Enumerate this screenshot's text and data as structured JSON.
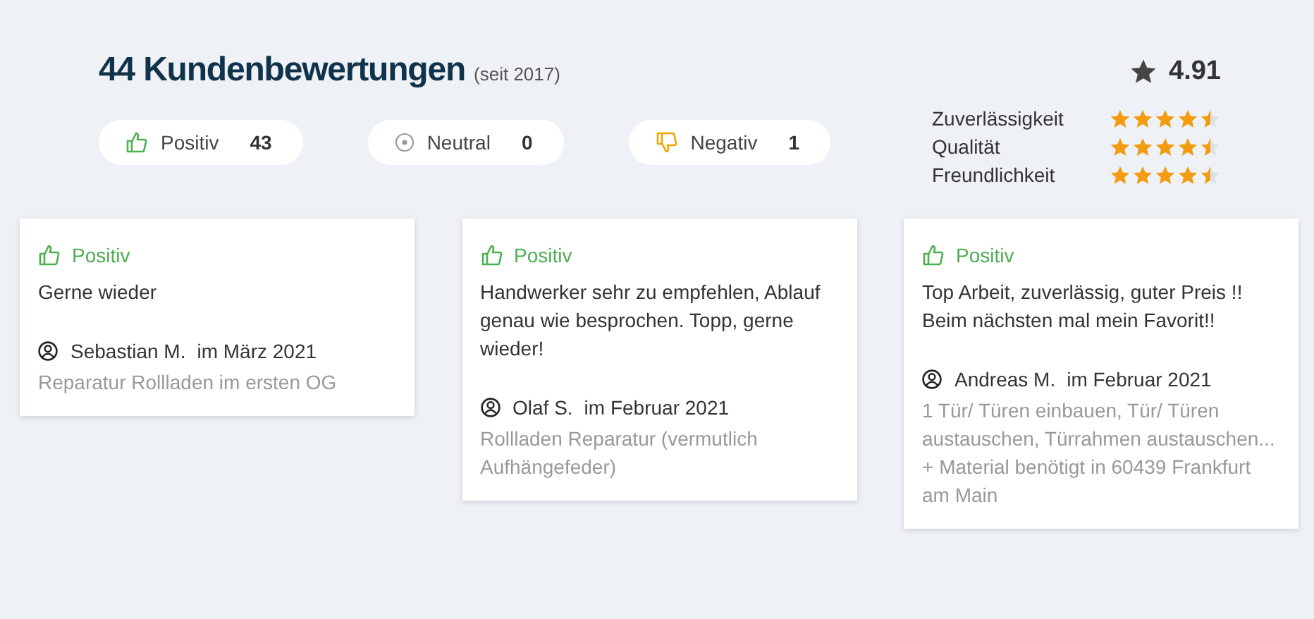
{
  "header": {
    "title": "44 Kundenbewertungen",
    "since": "(seit 2017)"
  },
  "filters": [
    {
      "kind": "positive",
      "label": "Positiv",
      "count": "43"
    },
    {
      "kind": "neutral",
      "label": "Neutral",
      "count": "0"
    },
    {
      "kind": "negative",
      "label": "Negativ",
      "count": "1"
    }
  ],
  "overall": {
    "score": "4.91"
  },
  "ratings": [
    {
      "label": "Zuverlässigkeit",
      "stars": 4.5
    },
    {
      "label": "Qualität",
      "stars": 4.5
    },
    {
      "label": "Freundlichkeit",
      "stars": 4.5
    }
  ],
  "reviews": [
    {
      "kind": "positive",
      "sentiment": "Positiv",
      "text": "Gerne wieder",
      "author": "Sebastian M.",
      "date": "im März 2021",
      "job": "Reparatur Rollladen im ersten OG"
    },
    {
      "kind": "positive",
      "sentiment": "Positiv",
      "text": "Handwerker sehr zu empfehlen, Ablauf genau wie besprochen. Topp, gerne wieder!",
      "author": "Olaf S.",
      "date": "im Februar 2021",
      "job": "Rollladen Reparatur (vermutlich Aufhängefeder)"
    },
    {
      "kind": "positive",
      "sentiment": "Positiv",
      "text": "Top Arbeit, zuverlässig, guter Preis !! Beim nächsten mal mein Favorit!!",
      "author": "Andreas M.",
      "date": "im Februar 2021",
      "job": "1 Tür/ Türen einbauen, Tür/ Türen austauschen, Türrahmen austauschen... + Material benötigt in 60439 Frankfurt am Main"
    }
  ]
}
